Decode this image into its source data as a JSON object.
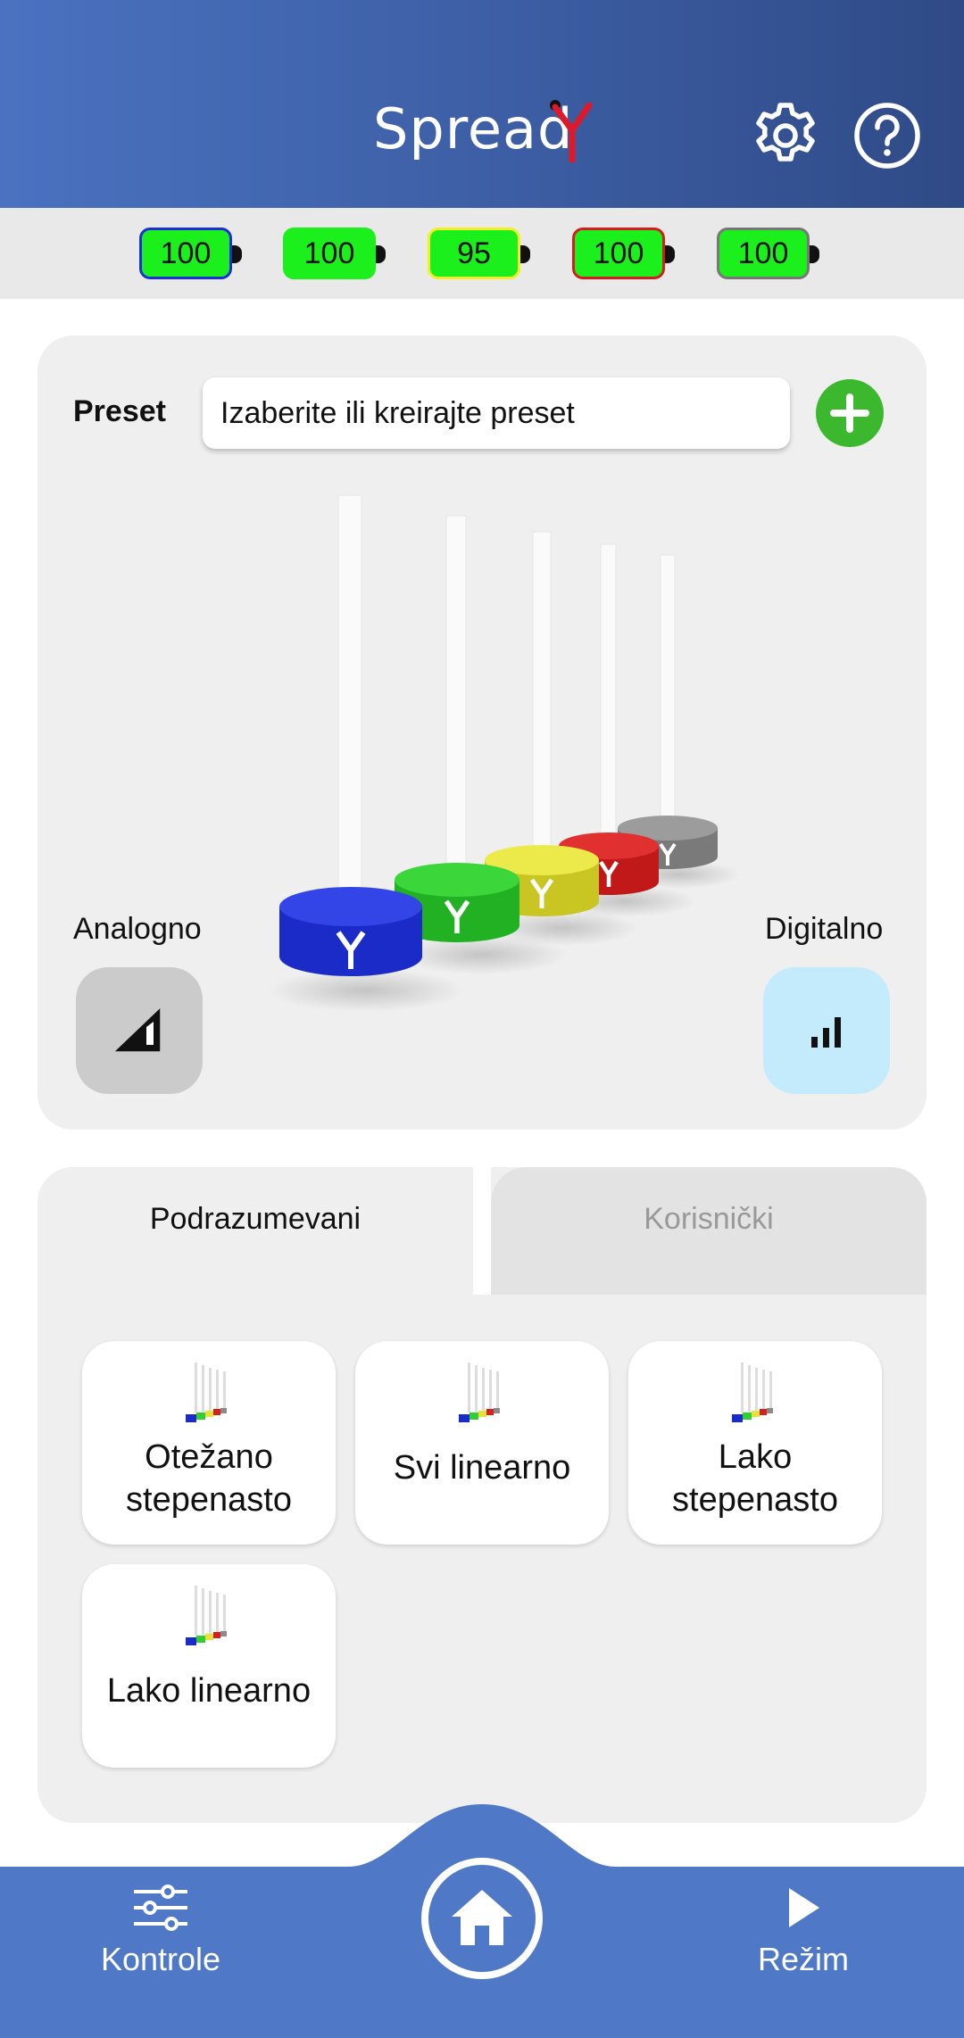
{
  "header": {
    "title": "Spread",
    "logo_accent_color": "#e0192a",
    "settings_icon": "gear-icon",
    "help_icon": "question-circle-icon"
  },
  "batteries": [
    {
      "level": "100",
      "border_color": "#1a2fd6"
    },
    {
      "level": "100",
      "border_color": "#1cf01c"
    },
    {
      "level": "95",
      "border_color": "#f2ef22"
    },
    {
      "level": "100",
      "border_color": "#d41c1c"
    },
    {
      "level": "100",
      "border_color": "#777777"
    }
  ],
  "preset": {
    "label": "Preset",
    "placeholder": "Izaberite ili kreirajte preset",
    "add_icon": "plus-circle-icon"
  },
  "scene": {
    "pillars": [
      {
        "color": "#1f2fd8"
      },
      {
        "color": "#2fd02f"
      },
      {
        "color": "#e6e23a"
      },
      {
        "color": "#d61e1e"
      },
      {
        "color": "#8a8a8a"
      }
    ]
  },
  "modes": {
    "analog_label": "Analogno",
    "digital_label": "Digitalno",
    "analog_icon": "analog-ramp-icon",
    "digital_icon": "signal-bars-icon"
  },
  "tabs": {
    "default_label": "Podrazumevani",
    "custom_label": "Korisnički"
  },
  "preset_tiles": [
    {
      "line1": "Otežano",
      "line2": "stepenasto"
    },
    {
      "line1": "Svi linearno",
      "line2": ""
    },
    {
      "line1": "Lako",
      "line2": "stepenasto"
    },
    {
      "line1": "Lako linearno",
      "line2": ""
    }
  ],
  "bottom_nav": {
    "controls_label": "Kontrole",
    "mode_label": "Režim",
    "home_icon": "home-icon",
    "nav_color": "#4f78c6"
  }
}
